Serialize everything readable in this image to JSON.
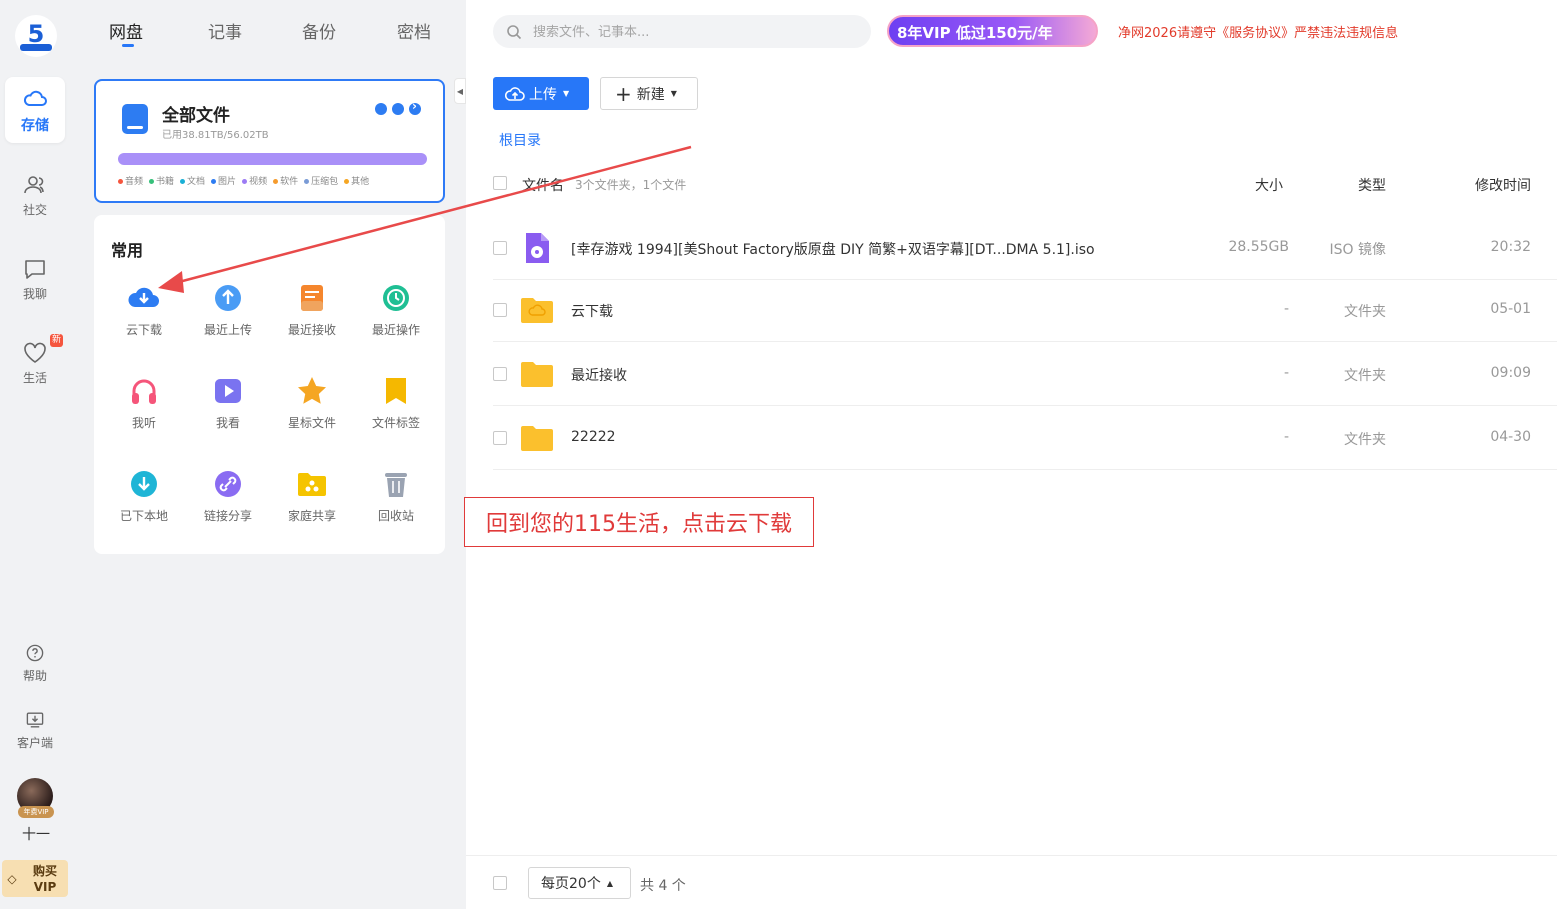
{
  "rail": {
    "items": [
      {
        "label": "存储",
        "icon": "cloud-icon"
      },
      {
        "label": "社交",
        "icon": "people-icon"
      },
      {
        "label": "我聊",
        "icon": "chat-icon"
      },
      {
        "label": "生活",
        "icon": "heart-icon",
        "badge": "新"
      }
    ],
    "help": "帮助",
    "client": "客户端",
    "avatar_tag": "年费VIP",
    "username": "十一",
    "buy_vip": "购买 VIP"
  },
  "tabs": [
    "网盘",
    "记事",
    "备份",
    "密档"
  ],
  "all_files": {
    "title": "全部文件",
    "usage": "已用38.81TB/56.02TB",
    "legend": [
      {
        "label": "音频",
        "color": "#f5553d"
      },
      {
        "label": "书籍",
        "color": "#36c07a"
      },
      {
        "label": "文档",
        "color": "#1ab0d6"
      },
      {
        "label": "图片",
        "color": "#2d7cf2"
      },
      {
        "label": "视频",
        "color": "#9c7bf4"
      },
      {
        "label": "软件",
        "color": "#f59b2d"
      },
      {
        "label": "压缩包",
        "color": "#7a9bd6"
      },
      {
        "label": "其他",
        "color": "#f5a623"
      }
    ]
  },
  "common": {
    "title": "常用",
    "items": [
      {
        "label": "云下载",
        "icon": "cloud-download-icon",
        "color": "#2d7cf2"
      },
      {
        "label": "最近上传",
        "icon": "upload-icon",
        "color": "#4a9cf5"
      },
      {
        "label": "最近接收",
        "icon": "inbox-icon",
        "color": "#f5862d"
      },
      {
        "label": "最近操作",
        "icon": "history-icon",
        "color": "#1fbf94"
      },
      {
        "label": "我听",
        "icon": "headphones-icon",
        "color": "#f5557a"
      },
      {
        "label": "我看",
        "icon": "video-icon",
        "color": "#7a73f0"
      },
      {
        "label": "星标文件",
        "icon": "star-icon",
        "color": "#f5a623"
      },
      {
        "label": "文件标签",
        "icon": "bookmark-icon",
        "color": "#f5b800"
      },
      {
        "label": "已下本地",
        "icon": "download-local-icon",
        "color": "#1fb5d6"
      },
      {
        "label": "链接分享",
        "icon": "link-icon",
        "color": "#8a6cf2"
      },
      {
        "label": "家庭共享",
        "icon": "family-folder-icon",
        "color": "#f5c400"
      },
      {
        "label": "回收站",
        "icon": "trash-icon",
        "color": "#9aa3b2"
      }
    ]
  },
  "search": {
    "placeholder": "搜索文件、记事本..."
  },
  "vip_banner": "8年VIP 低过150元/年",
  "notice": "净网2026请遵守《服务协议》严禁违法违规信息",
  "toolbar": {
    "upload": "上传",
    "new": "新建"
  },
  "breadcrumb": "根目录",
  "table": {
    "headers": {
      "name": "文件名",
      "count": "3个文件夹，1个文件",
      "size": "大小",
      "type": "类型",
      "time": "修改时间"
    },
    "rows": [
      {
        "name": "[幸存游戏 1994][美Shout Factory版原盘 DIY 简繁+双语字幕][DT...DMA 5.1].iso",
        "size": "28.55GB",
        "type": "ISO 镜像",
        "time": "20:32",
        "icon": "iso-file-icon"
      },
      {
        "name": "云下载",
        "size": "-",
        "type": "文件夹",
        "time": "05-01",
        "icon": "cloud-folder-icon"
      },
      {
        "name": "最近接收",
        "size": "-",
        "type": "文件夹",
        "time": "09:09",
        "icon": "folder-icon"
      },
      {
        "name": "22222",
        "size": "-",
        "type": "文件夹",
        "time": "04-30",
        "icon": "folder-icon"
      }
    ]
  },
  "footer": {
    "per_page": "每页20个",
    "total": "共 4 个"
  },
  "annotation": "回到您的115生活，点击云下载"
}
